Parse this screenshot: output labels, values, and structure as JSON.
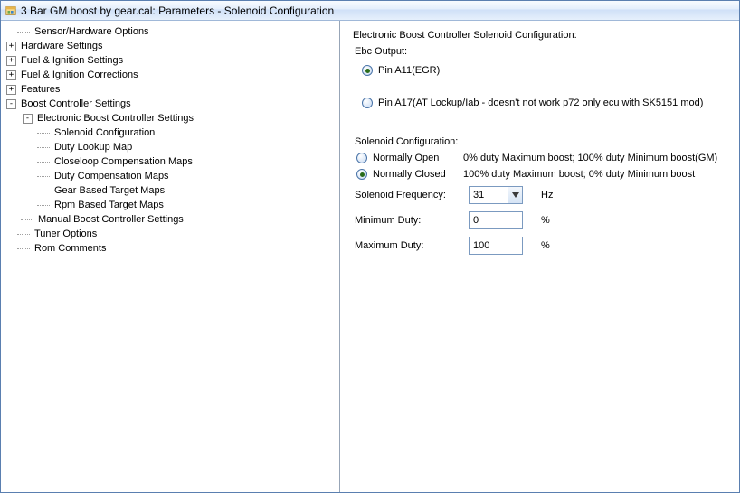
{
  "window": {
    "title": "3 Bar GM boost by gear.cal: Parameters - Solenoid Configuration"
  },
  "tree": {
    "n0": "Sensor/Hardware Options",
    "n1": "Hardware Settings",
    "n2": "Fuel & Ignition Settings",
    "n3": "Fuel & Ignition Corrections",
    "n4": "Features",
    "n5": "Boost Controller Settings",
    "n5_0": "Electronic Boost Controller Settings",
    "n5_0_0": "Solenoid Configuration",
    "n5_0_1": "Duty Lookup Map",
    "n5_0_2": "Closeloop Compensation Maps",
    "n5_0_3": "Duty Compensation Maps",
    "n5_0_4": "Gear Based Target Maps",
    "n5_0_5": "Rpm Based Target Maps",
    "n5_1": "Manual Boost Controller Settings",
    "n6": "Tuner Options",
    "n7": "Rom Comments"
  },
  "right": {
    "heading": "Electronic Boost Controller Solenoid Configuration:",
    "ebc": {
      "legend": "Ebc Output:",
      "opt0": "Pin A11(EGR)",
      "opt1": "Pin A17(AT Lockup/Iab - doesn't not work p72 only ecu with SK5151 mod)"
    },
    "sol": {
      "legend": "Solenoid Configuration:",
      "open_label": "Normally Open",
      "open_desc": "0% duty Maximum boost; 100% duty Minimum boost(GM)",
      "closed_label": "Normally Closed",
      "closed_desc": "100% duty Maximum boost; 0% duty Minimum boost",
      "freq_label": "Solenoid Frequency:",
      "freq_value": "31",
      "freq_unit": "Hz",
      "min_label": "Minimum Duty:",
      "min_value": "0",
      "min_unit": "%",
      "max_label": "Maximum Duty:",
      "max_value": "100",
      "max_unit": "%"
    }
  }
}
